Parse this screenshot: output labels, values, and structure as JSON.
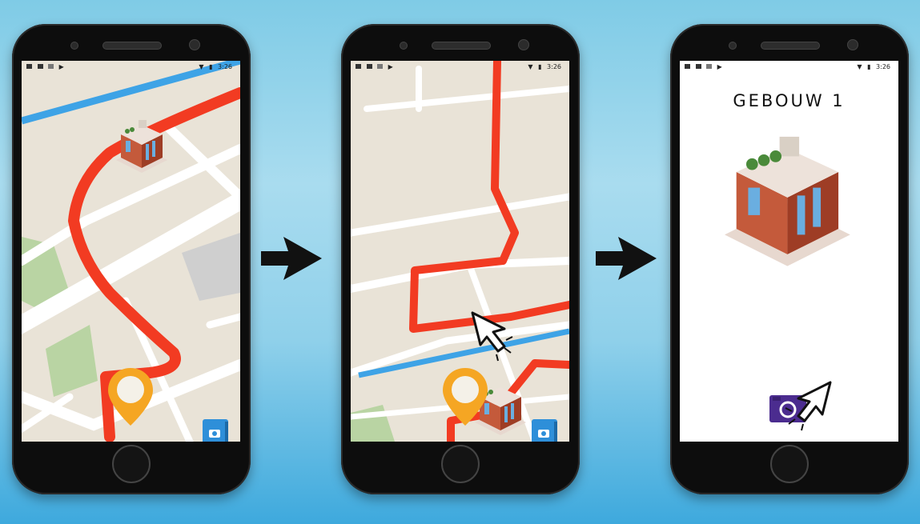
{
  "phones": [
    {
      "status": {
        "time": "3:26"
      },
      "screen": "map-route",
      "icons": [
        "building-icon",
        "location-pin-icon",
        "camera-book-icon"
      ]
    },
    {
      "status": {
        "time": "3:26"
      },
      "screen": "map-arrived",
      "icons": [
        "building-icon",
        "location-pin-icon",
        "camera-book-icon",
        "cursor-arrow-icon"
      ]
    },
    {
      "status": {
        "time": "3:26"
      },
      "screen": "building-detail",
      "title": "GEBOUW 1",
      "icons": [
        "building-icon",
        "camera-button-icon",
        "cursor-arrow-icon"
      ]
    }
  ],
  "colors": {
    "route": "#f23b22",
    "water": "#3ea3e6",
    "pin": "#f5a623",
    "camera_book": "#2e8fd9",
    "camera_button": "#4b2c8f",
    "map_bg": "#e9e3d7",
    "park": "#b9d4a3"
  }
}
